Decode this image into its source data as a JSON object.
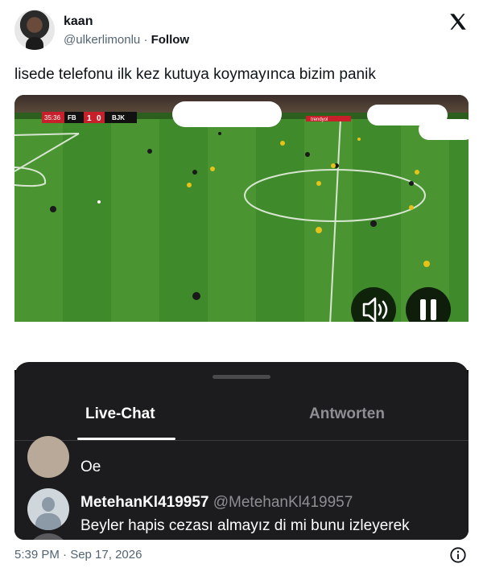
{
  "tweet": {
    "author_name": "kaan",
    "handle": "@ulkerlimonlu",
    "separator": "·",
    "follow_label": "Follow",
    "text": "lisede telefonu ilk kez kutuya koymayınca bizim panik",
    "timestamp": "5:39 PM · Sep 17, 2026"
  },
  "video": {
    "scoreboard": {
      "time": "35:36",
      "home": "FB",
      "home_score": "1",
      "away_score": "0",
      "away": "BJK"
    },
    "ad_text": "trendyol"
  },
  "sheet": {
    "tabs": [
      {
        "label": "Live-Chat",
        "active": true
      },
      {
        "label": "Antworten",
        "active": false
      }
    ],
    "messages": [
      {
        "text": "Oe"
      },
      {
        "user": "MetehanKl419957",
        "handle": "@MetehanKl419957",
        "text": "Beyler hapis cezası almayız di mi bunu izleyerek"
      }
    ]
  },
  "colors": {
    "pitch": "#3f8a2a",
    "sheet": "#1c1c1e",
    "accent": "#0f1419"
  },
  "icons": [
    "x-logo-icon",
    "volume-icon",
    "pause-icon",
    "info-icon"
  ]
}
